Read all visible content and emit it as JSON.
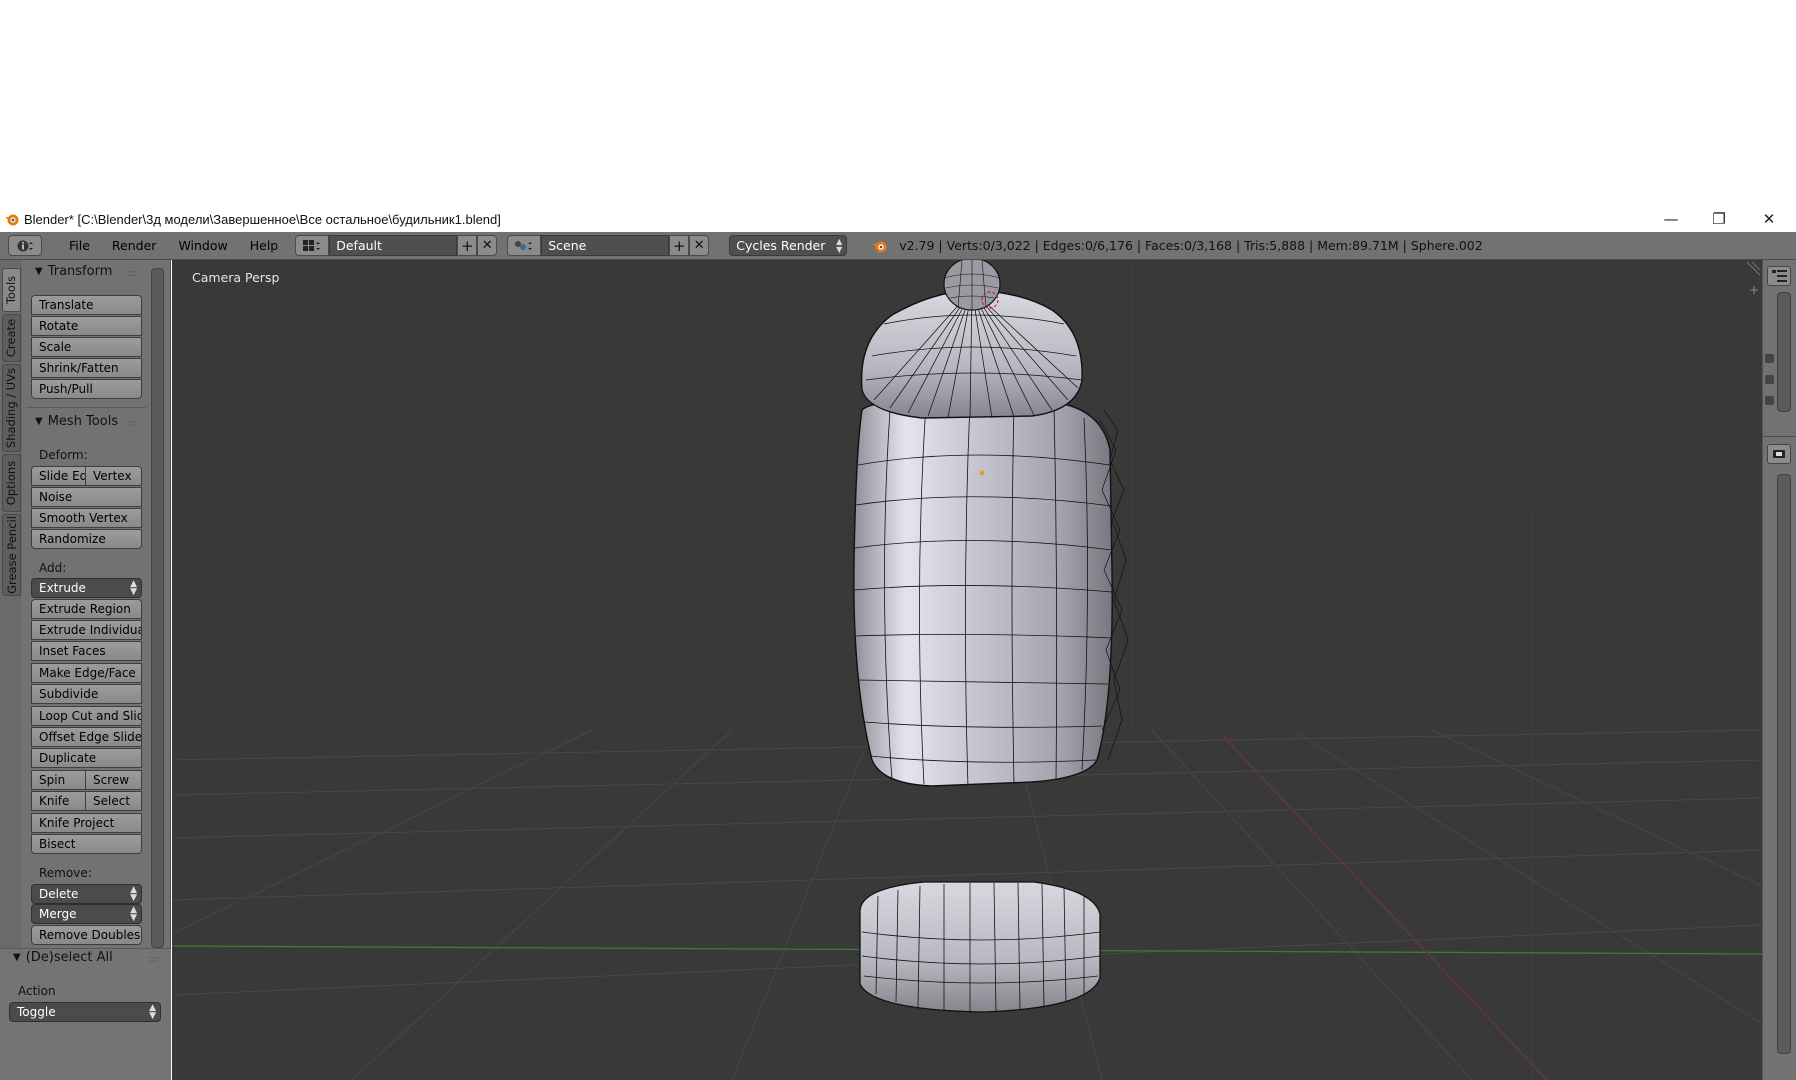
{
  "window": {
    "title": "Blender* [C:\\Blender\\3д модели\\Завершенное\\Все остальное\\будильник1.blend]",
    "controls": {
      "minimize": "—",
      "restore": "❐",
      "close": "✕"
    }
  },
  "header": {
    "menus": [
      "File",
      "Render",
      "Window",
      "Help"
    ],
    "screen_layout": "Default",
    "scene": "Scene",
    "render_engine": "Cycles Render",
    "stats": "v2.79 | Verts:0/3,022 | Edges:0/6,176 | Faces:0/3,168 | Tris:5,888 | Mem:89.71M | Sphere.002"
  },
  "tabs": [
    "Tools",
    "Create",
    "Shading / UVs",
    "Options",
    "Grease Pencil"
  ],
  "transform": {
    "title": "Transform",
    "buttons": [
      "Translate",
      "Rotate",
      "Scale",
      "Shrink/Fatten",
      "Push/Pull"
    ]
  },
  "mesh_tools": {
    "title": "Mesh Tools",
    "deform_label": "Deform:",
    "deform": {
      "slide_edge": "Slide Ed",
      "vertex": "Vertex",
      "noise": "Noise",
      "smooth_vertex": "Smooth Vertex",
      "randomize": "Randomize"
    },
    "add_label": "Add:",
    "extrude_dropdown": "Extrude",
    "add": {
      "extrude_region": "Extrude Region",
      "extrude_individual": "Extrude Individual",
      "inset_faces": "Inset Faces",
      "make_edge_face": "Make Edge/Face",
      "subdivide": "Subdivide",
      "loop_cut": "Loop Cut and Slide",
      "offset_edge_slide": "Offset Edge Slide",
      "duplicate": "Duplicate",
      "spin": "Spin",
      "screw": "Screw",
      "knife": "Knife",
      "select": "Select",
      "knife_project": "Knife Project",
      "bisect": "Bisect"
    },
    "remove_label": "Remove:",
    "delete_dropdown": "Delete",
    "merge_dropdown": "Merge",
    "remove_doubles": "Remove Doubles"
  },
  "deselect_all": {
    "title": "(De)select All",
    "action_label": "Action",
    "action_value": "Toggle"
  },
  "viewport": {
    "label": "Camera Persp"
  },
  "colors": {
    "panel": "#727272",
    "viewport": "#393939",
    "grid": "#4a4a4a",
    "x_axis": "#7a3a3a",
    "y_axis": "#3f7a2f",
    "mesh_wire": "#111111"
  }
}
